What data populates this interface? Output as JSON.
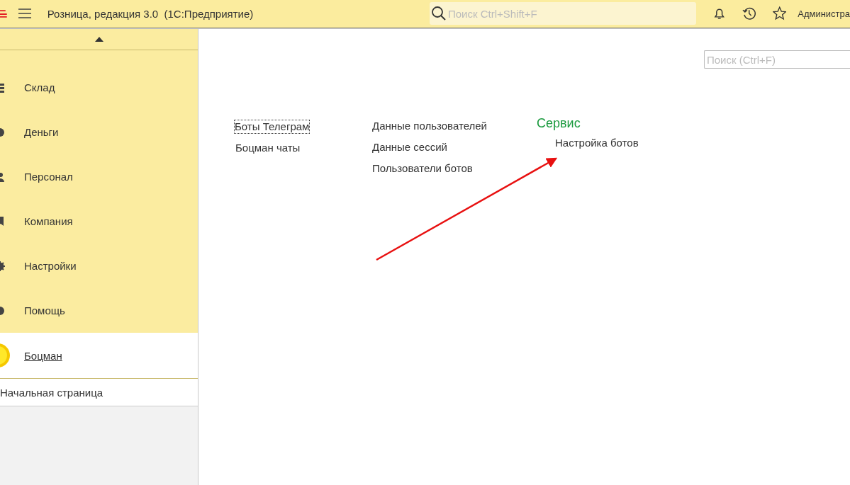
{
  "header": {
    "title": "Розница, редакция 3.0  (1С:Предприятие)",
    "search": {
      "placeholder": "Поиск Ctrl+Shift+F"
    },
    "user": "Администра"
  },
  "sidebar": {
    "items": [
      {
        "label": "Склад",
        "selected": false
      },
      {
        "label": "Деньги",
        "selected": false
      },
      {
        "label": "Персонал",
        "selected": false
      },
      {
        "label": "Компания",
        "selected": false
      },
      {
        "label": "Настройки",
        "selected": false
      },
      {
        "label": "Помощь",
        "selected": false
      },
      {
        "label": "Боцман",
        "selected": true
      }
    ],
    "home": "Начальная страница"
  },
  "content": {
    "search": {
      "placeholder": "Поиск (Ctrl+F)"
    },
    "columns": [
      {
        "items": [
          {
            "label": "Боты Телеграм",
            "focused": true
          },
          {
            "label": "Боцман чаты",
            "focused": false
          }
        ]
      },
      {
        "items": [
          {
            "label": "Данные пользователей",
            "focused": false
          },
          {
            "label": "Данные сессий",
            "focused": false
          },
          {
            "label": "Пользователи ботов",
            "focused": false
          }
        ]
      },
      {
        "heading": "Сервис",
        "items": [
          {
            "label": "Настройка ботов",
            "focused": false
          }
        ]
      }
    ]
  }
}
